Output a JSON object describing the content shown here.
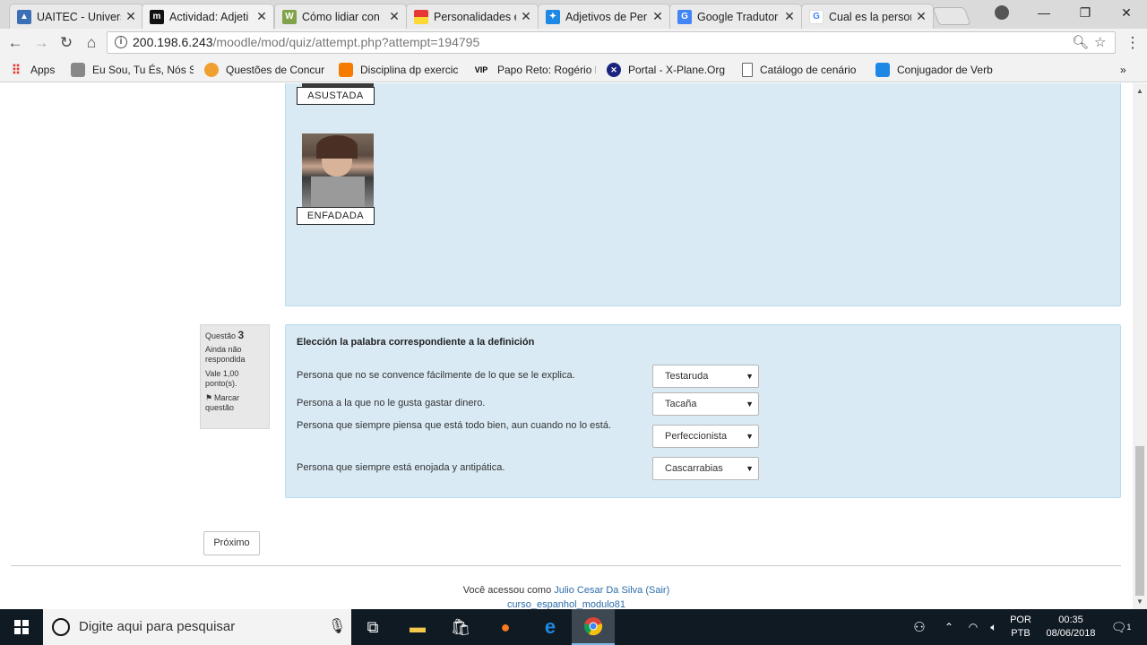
{
  "browser": {
    "tabs": [
      {
        "title": "UAITEC - Univers",
        "favicon_color": "#3b6fb6",
        "favicon_glyph": "▲"
      },
      {
        "title": "Actividad: Adjeti",
        "favicon_color": "#111111",
        "favicon_glyph": "m"
      },
      {
        "title": "Cómo lidiar con",
        "favicon_color": "#7fa24a",
        "favicon_glyph": "W"
      },
      {
        "title": "Personalidades e",
        "favicon_color": "#e53935",
        "favicon_glyph": ""
      },
      {
        "title": "Adjetivos de Per",
        "favicon_color": "#1e88e5",
        "favicon_glyph": "✦"
      },
      {
        "title": "Google Tradutor",
        "favicon_color": "#4285f4",
        "favicon_glyph": "G"
      },
      {
        "title": "Cual es la person",
        "favicon_color": "#ffffff",
        "favicon_glyph": "G"
      }
    ],
    "active_tab": 1,
    "url_host": "200.198.6.243",
    "url_path": "/moodle/mod/quiz/attempt.php?attempt=194795",
    "window_controls": {
      "minimize": "—",
      "maximize": "❐",
      "close": "✕"
    },
    "nav": {
      "back": "←",
      "forward": "→",
      "reload": "↻",
      "home": "⌂"
    }
  },
  "bookmarks": [
    {
      "label": "Apps",
      "icon": "apps-grid-icon",
      "color": "#e53935"
    },
    {
      "label": "Eu Sou, Tu És, Nós S",
      "icon": "search-person-icon",
      "color": "#888888"
    },
    {
      "label": "Questões de Concur",
      "icon": "qc-icon",
      "color": "#f0a030"
    },
    {
      "label": "Disciplina dp exercic",
      "icon": "disciplina-icon",
      "color": "#f57c00"
    },
    {
      "label": "Papo Reto: Rogério F",
      "icon": "vip-icon",
      "color": "#000000"
    },
    {
      "label": "Portal - X-Plane.Org",
      "icon": "xplane-icon",
      "color": "#1a237e"
    },
    {
      "label": "Catálogo de cenário",
      "icon": "page-icon",
      "color": "#ffffff"
    },
    {
      "label": "Conjugador de Verb",
      "icon": "conjugador-icon",
      "color": "#1e88e5"
    }
  ],
  "question1": {
    "images": [
      {
        "caption": "ASUSTADA"
      },
      {
        "caption": "ENFADADA"
      }
    ]
  },
  "question3": {
    "info": {
      "label": "Questão",
      "number": "3",
      "status": "Ainda não respondida",
      "grade": "Vale 1,00 ponto(s).",
      "flag": "Marcar questão"
    },
    "title": "Elección la palabra correspondiente a la definición",
    "rows": [
      {
        "text": "Persona que no se convence fácilmente de lo que se le explica.",
        "answer": "Testaruda"
      },
      {
        "text": "Persona a la que no le gusta gastar dinero.",
        "answer": "Tacaña"
      },
      {
        "text": "Persona que siempre piensa que está todo bien, aun cuando no lo está.",
        "answer": "Perfeccionista"
      },
      {
        "text": "Persona que siempre está enojada y antipática.",
        "answer": "Cascarrabias"
      }
    ]
  },
  "next_button": "Próximo",
  "footer": {
    "prefix": "Você acessou como",
    "user": "Julio Cesar Da Silva",
    "logout": "(Sair)",
    "course": "curso_espanhol_modulo81"
  },
  "taskbar": {
    "search_placeholder": "Digite aqui para pesquisar",
    "lang": "POR",
    "layout": "PTB",
    "time": "00:35",
    "date": "08/06/2018",
    "notifications": "1"
  }
}
